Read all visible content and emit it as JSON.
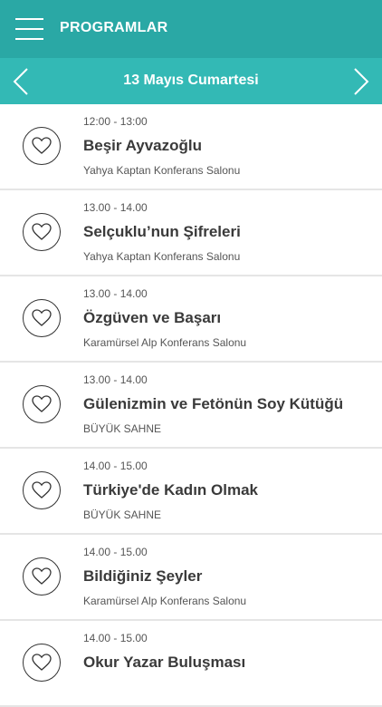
{
  "header": {
    "title": "PROGRAMLAR",
    "menu_icon": "hamburger-menu-icon"
  },
  "datebar": {
    "date": "13 Mayıs Cumartesi",
    "prev_icon": "chevron-left-icon",
    "next_icon": "chevron-right-icon"
  },
  "colors": {
    "header": "#2aa8a5",
    "datebar": "#33b9b5"
  },
  "events": [
    {
      "time": "12:00 - 13:00",
      "title": "Beşir  Ayvazoğlu",
      "venue": "Yahya Kaptan Konferans Salonu"
    },
    {
      "time": "13.00 - 14.00",
      "title": "Selçuklu’nun Şifreleri",
      "venue": "Yahya Kaptan Konferans Salonu"
    },
    {
      "time": "13.00 - 14.00",
      "title": "Özgüven ve Başarı",
      "venue": "Karamürsel Alp Konferans Salonu"
    },
    {
      "time": "13.00 - 14.00",
      "title": "Gülenizmin ve Fetönün Soy Kütüğü",
      "venue": "BÜYÜK SAHNE"
    },
    {
      "time": "14.00 - 15.00",
      "title": "Türkiye'de Kadın Olmak",
      "venue": "BÜYÜK SAHNE"
    },
    {
      "time": "14.00 - 15.00",
      "title": "Bildiğiniz Şeyler",
      "venue": "Karamürsel Alp Konferans Salonu"
    },
    {
      "time": "14.00 - 15.00",
      "title": "Okur Yazar Buluşması",
      "venue": ""
    }
  ]
}
